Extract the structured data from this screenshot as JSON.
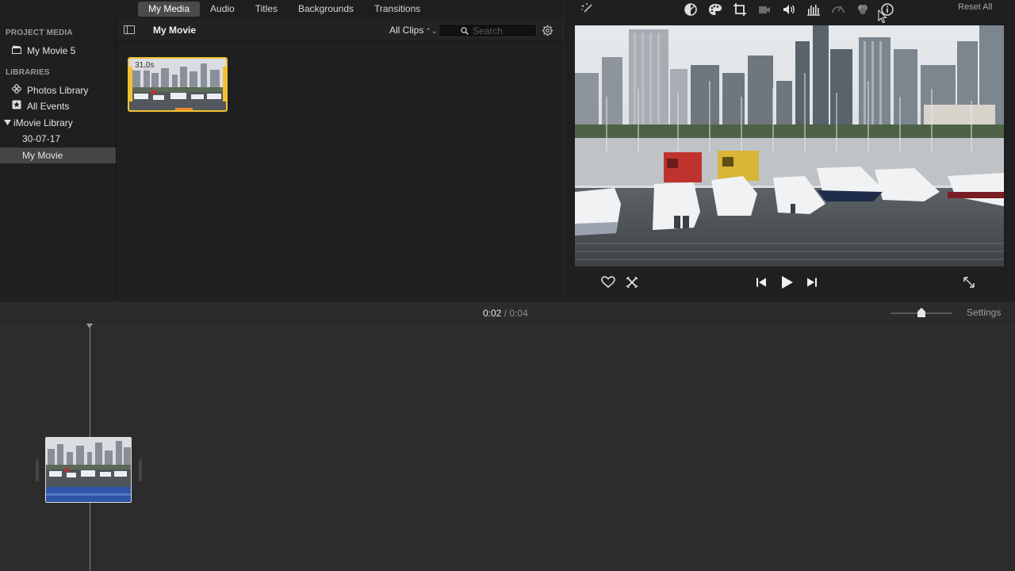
{
  "media_tabs": [
    {
      "label": "My Media",
      "active": true
    },
    {
      "label": "Audio",
      "active": false
    },
    {
      "label": "Titles",
      "active": false
    },
    {
      "label": "Backgrounds",
      "active": false
    },
    {
      "label": "Transitions",
      "active": false
    }
  ],
  "sidebar": {
    "project_heading": "PROJECT MEDIA",
    "project_item": {
      "label": "My Movie 5",
      "icon": "clapperboard-icon"
    },
    "libraries_heading": "LIBRARIES",
    "items": [
      {
        "label": "Photos Library",
        "icon": "photos-icon"
      },
      {
        "label": "All Events",
        "icon": "star-icon"
      },
      {
        "label": "iMovie Library",
        "icon": "disclosure-triangle-icon"
      },
      {
        "label": "30-07-17"
      },
      {
        "label": "My Movie",
        "selected": true
      }
    ]
  },
  "browser": {
    "title": "My Movie",
    "filter": "All Clips",
    "search_placeholder": "Search",
    "clip": {
      "duration": "31.0s"
    }
  },
  "viewer": {
    "reset_label": "Reset All",
    "tools": [
      "magic-wand-icon",
      "color-balance-icon",
      "color-correction-icon",
      "crop-icon",
      "stabilization-icon",
      "volume-icon",
      "noise-reduction-icon",
      "speed-icon",
      "clip-filter-icon",
      "info-icon"
    ]
  },
  "timeline": {
    "current": "0:02",
    "separator": "/",
    "total": "0:04",
    "settings_label": "Settings",
    "zoom_level": 0.5
  },
  "colors": {
    "selection": "#f1c232",
    "audio": "#2e56a8",
    "panel": "#1f1f1f",
    "timeline": "#2c2c2c"
  }
}
